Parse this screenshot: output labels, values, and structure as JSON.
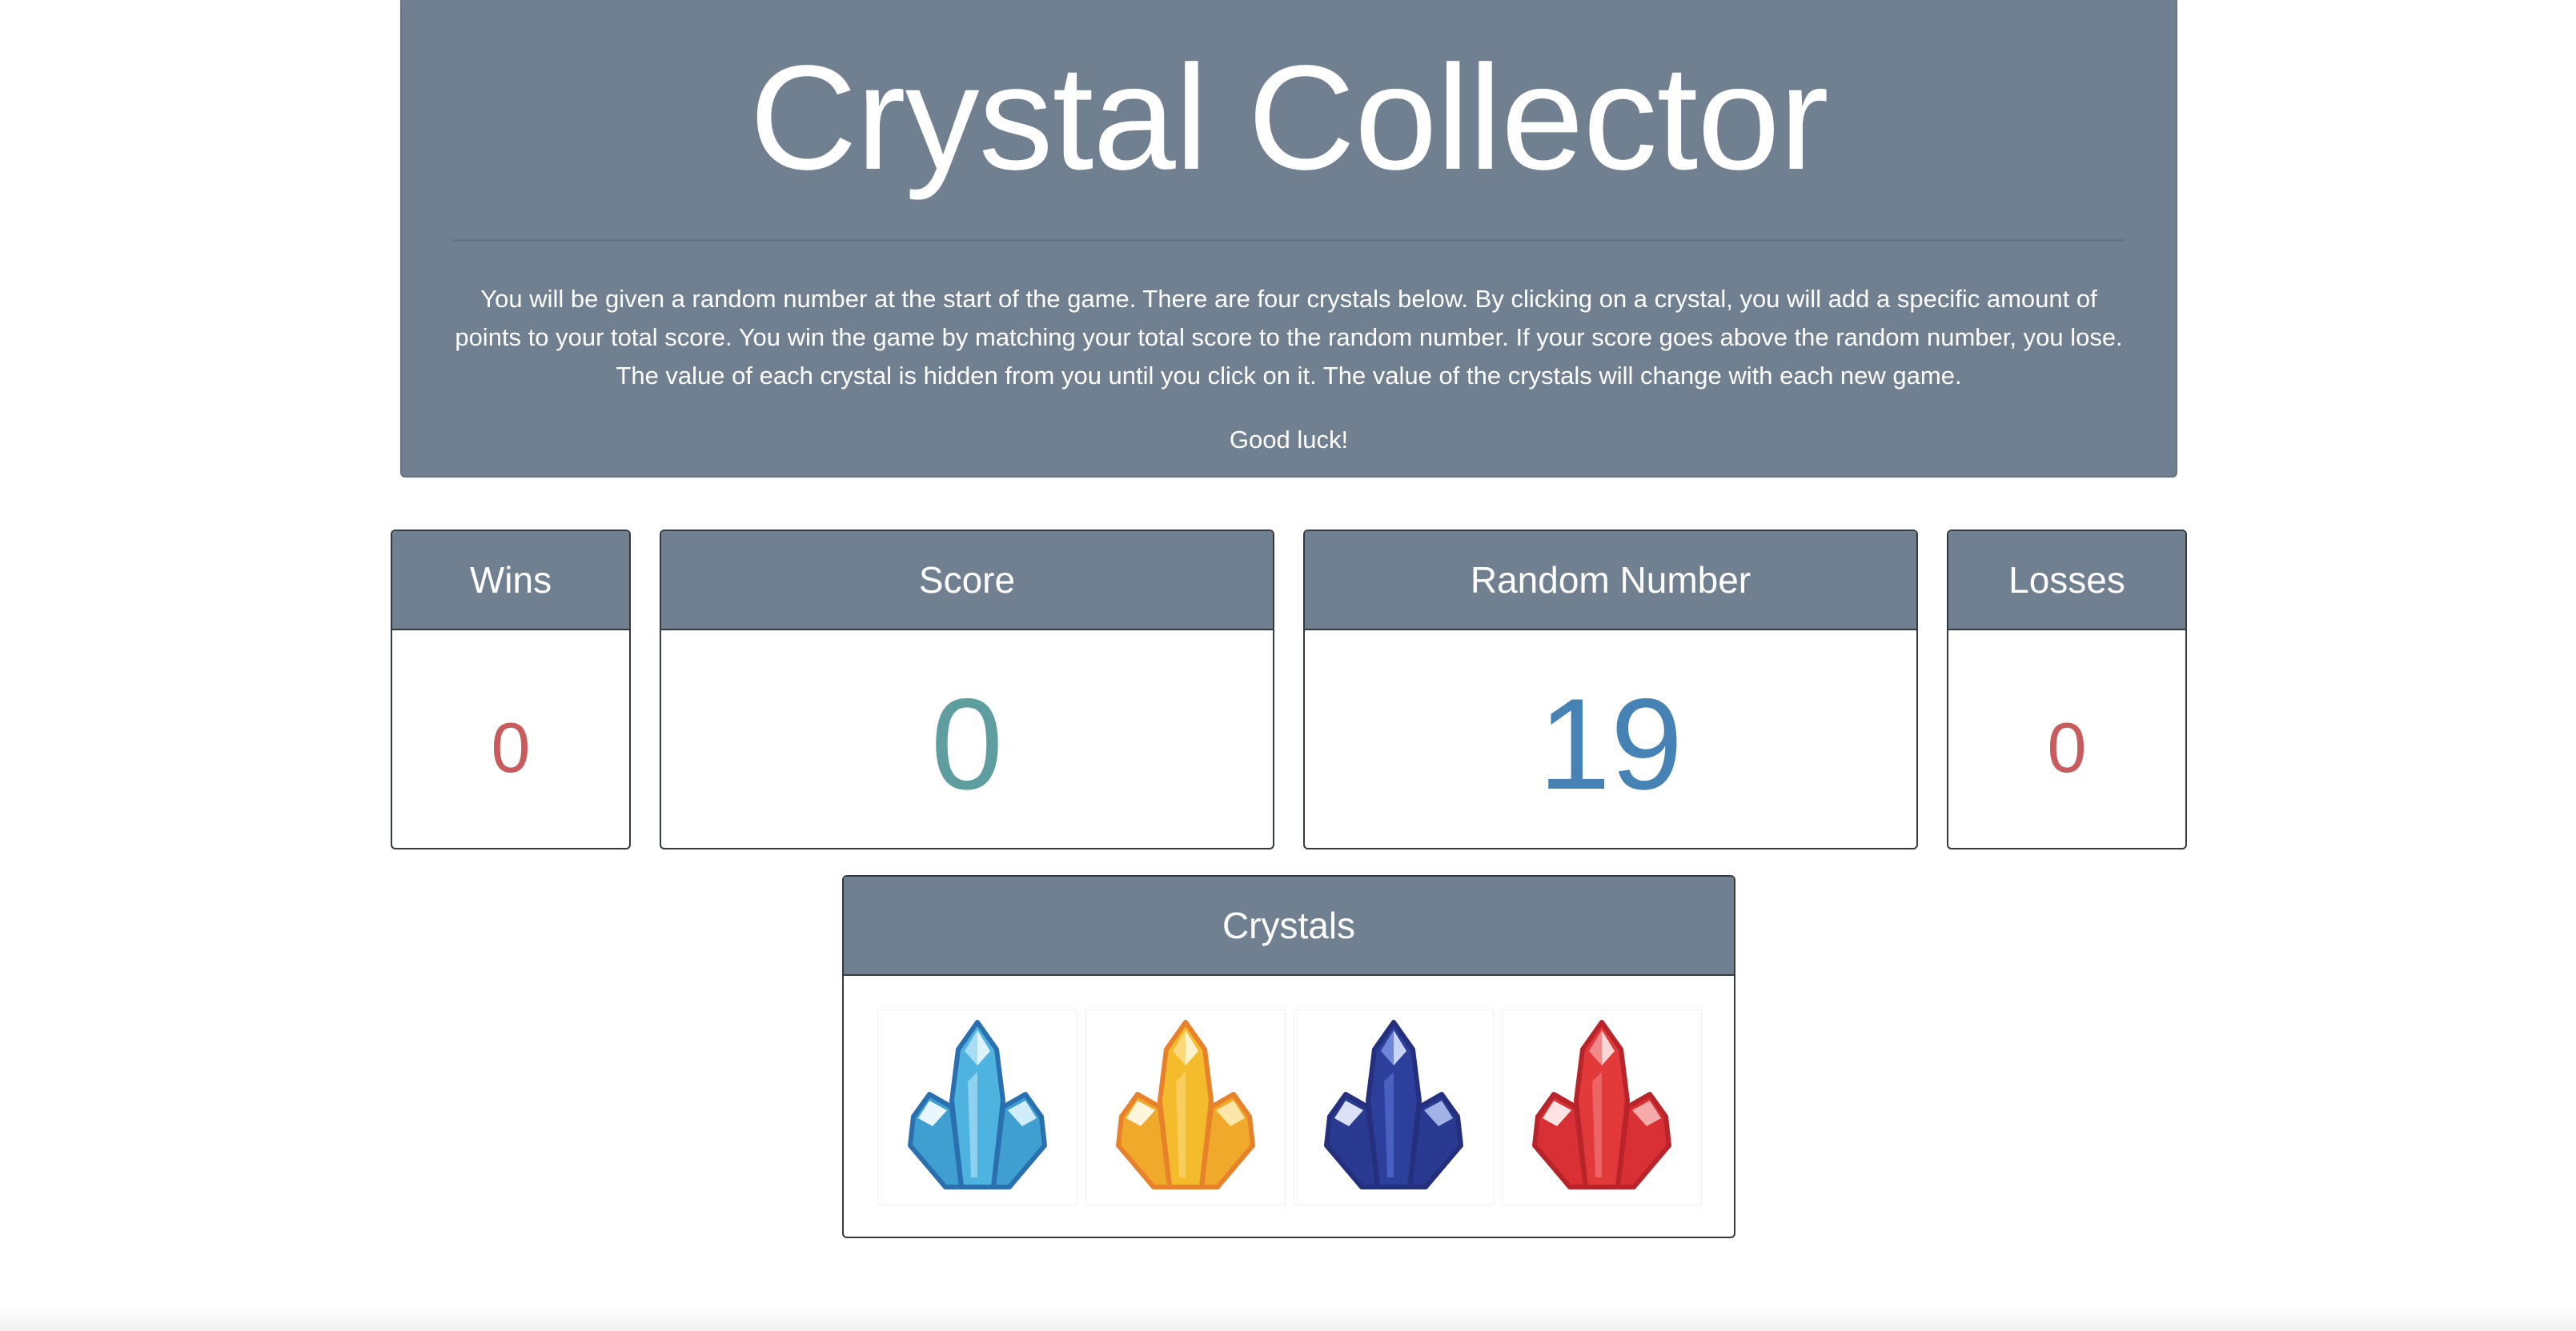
{
  "header": {
    "title": "Crystal Collector",
    "description": "You will be given a random number at the start of the game. There are four crystals below. By clicking on a crystal, you will add a specific amount of points to your total score. You win the game by matching your total score to the random number. If your score goes above the random number, you lose. The value of each crystal is hidden from you until you click on it. The value of the crystals will change with each new game.",
    "sign_off": "Good luck!"
  },
  "stats": {
    "wins": {
      "label": "Wins",
      "value": "0"
    },
    "score": {
      "label": "Score",
      "value": "0"
    },
    "random_number": {
      "label": "Random Number",
      "value": "19"
    },
    "losses": {
      "label": "Losses",
      "value": "0"
    }
  },
  "crystals": {
    "label": "Crystals",
    "items": [
      {
        "name": "light-blue-crystal-icon",
        "color": "#4fb3e0"
      },
      {
        "name": "yellow-crystal-icon",
        "color": "#f4bc2c"
      },
      {
        "name": "dark-blue-crystal-icon",
        "color": "#2c3f9a"
      },
      {
        "name": "red-crystal-icon",
        "color": "#e2393b"
      }
    ]
  },
  "colors": {
    "panel": "#708090",
    "wins_losses_value": "#c75b5e",
    "score_value": "#5f9ea0",
    "random_value": "#4682b4"
  }
}
